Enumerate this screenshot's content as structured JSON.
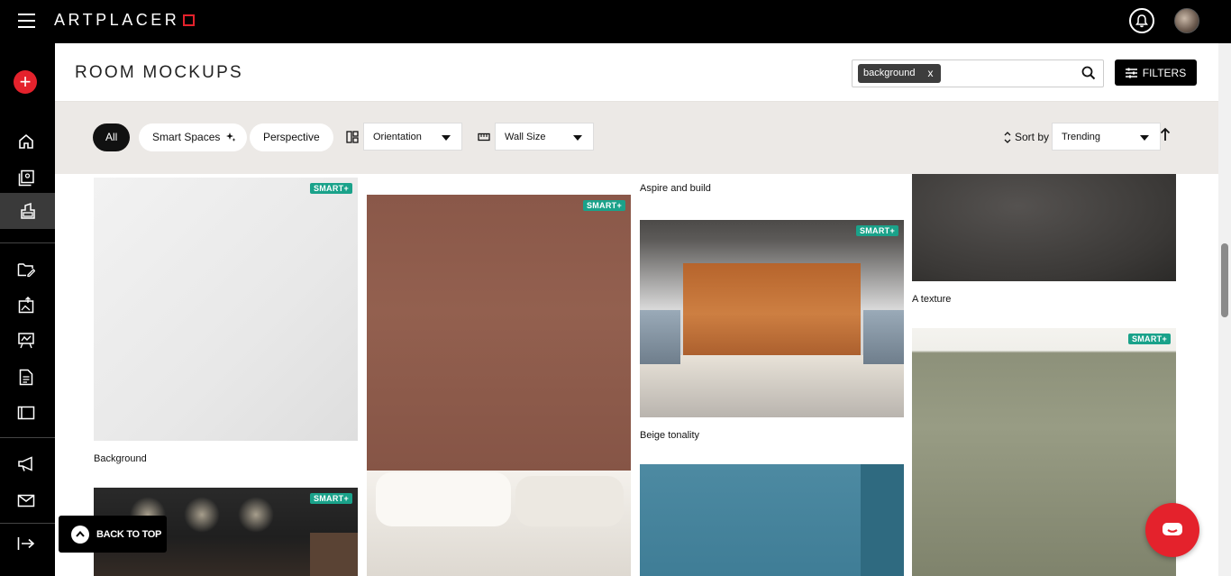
{
  "app": {
    "logo": "ARTPLACER"
  },
  "header": {
    "title": "ROOM MOCKUPS"
  },
  "search": {
    "chip": "background",
    "chip_close": "x",
    "placeholder": ""
  },
  "filters_button": "FILTERS",
  "filterbar": {
    "pills": [
      "All",
      "Smart Spaces",
      "Perspective"
    ],
    "orientation": "Orientation",
    "wall_size": "Wall Size",
    "sort_label": "Sort by",
    "sort_value": "Trending"
  },
  "cards": {
    "c1": {
      "caption": "Background",
      "smart": "SMART"
    },
    "c2": {
      "smart": "SMART"
    },
    "c3": {
      "smart": "SMART"
    },
    "c4": {
      "caption": "Aspire and build"
    },
    "c5": {
      "caption": "Beige tonality",
      "smart": "SMART"
    },
    "c6": {},
    "c7": {
      "caption": "A texture"
    },
    "c8": {
      "smart": "SMART"
    }
  },
  "back_to_top": "BACK TO TOP",
  "colors": {
    "brand_red": "#e4222c",
    "smart_badge": "#1aa28a"
  }
}
